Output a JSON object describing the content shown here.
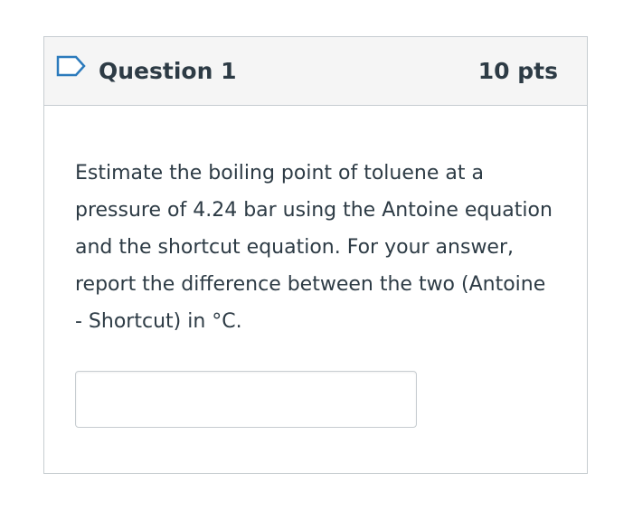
{
  "question": {
    "title": "Question 1",
    "points": "10 pts",
    "text": "Estimate the boiling point of toluene at a pressure of 4.24 bar using the Antoine equation and the shortcut equation. For your answer, report the difference between the two (Antoine - Shortcut) in °C.",
    "answer_value": "",
    "answer_placeholder": ""
  },
  "icons": {
    "flag": "flag-outline-icon"
  },
  "colors": {
    "text": "#2d3b45",
    "header_bg": "#f5f5f5",
    "border": "#c7cdd1",
    "flag_stroke": "#2b7abc"
  }
}
